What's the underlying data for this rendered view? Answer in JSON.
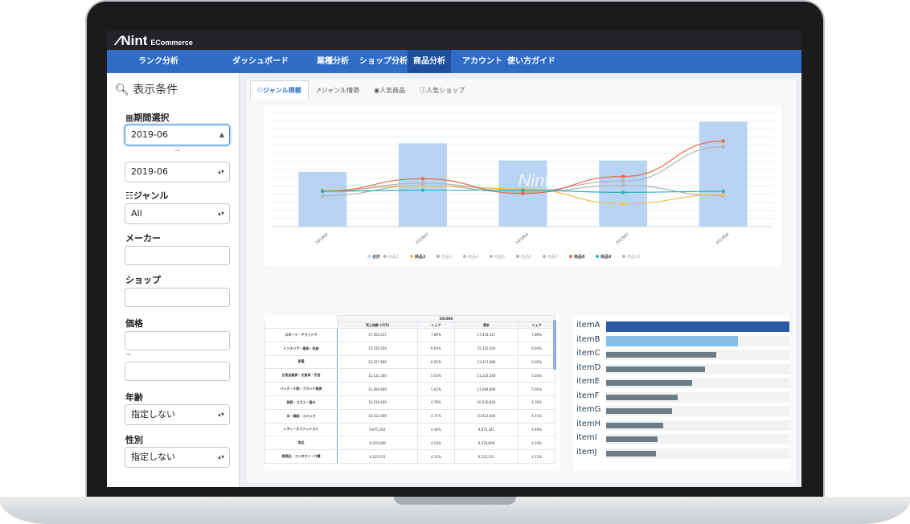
{
  "app": {
    "logo_mark": "∕∕",
    "logo_name": "Nint",
    "logo_sub": "ECommerce"
  },
  "nav": [
    {
      "label": "ランク分析",
      "active": false
    },
    {
      "label": "ダッシュボード",
      "active": false
    },
    {
      "label": "業種分析",
      "active": false
    },
    {
      "label": "ショップ分析",
      "active": false
    },
    {
      "label": "商品分析",
      "active": true
    },
    {
      "label": "アカウント",
      "active": false
    },
    {
      "label": "使い方ガイド",
      "active": false
    }
  ],
  "sidebar": {
    "title": "表示条件",
    "period_label": "期間選択",
    "period_from": "2019-06",
    "period_sep": "~",
    "period_to": "2019-06",
    "genre_label": "ジャンル",
    "genre_value": "All",
    "maker_label": "メーカー",
    "shop_label": "ショップ",
    "price_label": "価格",
    "price_sep": "~",
    "age_label": "年齢",
    "age_value": "指定しない",
    "gender_label": "性別",
    "gender_value": "指定しない"
  },
  "tabs": [
    {
      "label": "ジャンル規模",
      "icon": "users-icon",
      "active": true
    },
    {
      "label": "ジャンル情勢",
      "icon": "line-chart-icon",
      "active": false
    },
    {
      "label": "人気商品",
      "icon": "eye-icon",
      "active": false
    },
    {
      "label": "人気ショップ",
      "icon": "info-icon",
      "active": false
    }
  ],
  "chart_data": {
    "type": "bar",
    "categories": [
      "201902",
      "201903",
      "201904",
      "201905",
      "201906"
    ],
    "ylim": [
      0,
      100
    ],
    "grid": true,
    "legend_position": "bottom",
    "watermark": "Nint",
    "series": [
      {
        "name": "合計",
        "kind": "bar",
        "color": "#b9d4f3",
        "values": [
          48,
          73,
          58,
          58,
          92
        ]
      },
      {
        "name": "商品1",
        "kind": "line",
        "color": "#b0b4b8",
        "values": [
          27,
          36,
          30,
          36,
          27
        ]
      },
      {
        "name": "商品2",
        "kind": "line",
        "color": "#f0c050",
        "values": [
          32,
          36,
          33,
          20,
          28
        ]
      },
      {
        "name": "商品3",
        "kind": "line",
        "color": "#b0b4b8",
        "values": [
          31,
          38,
          31,
          40,
          70
        ]
      },
      {
        "name": "商品4",
        "kind": "line",
        "color": "#b0b4b8",
        "values": []
      },
      {
        "name": "商品5",
        "kind": "line",
        "color": "#b0b4b8",
        "values": []
      },
      {
        "name": "商品6",
        "kind": "line",
        "color": "#b0b4b8",
        "values": []
      },
      {
        "name": "商品7",
        "kind": "line",
        "color": "#b0b4b8",
        "values": []
      },
      {
        "name": "商品8",
        "kind": "line",
        "color": "#e8684a",
        "values": [
          31,
          42,
          29,
          44,
          75
        ]
      },
      {
        "name": "商品9",
        "kind": "line",
        "color": "#2ab0b8",
        "values": [
          31,
          32,
          32,
          30,
          31
        ]
      },
      {
        "name": "商品10",
        "kind": "line",
        "color": "#b0b4b8",
        "values": []
      }
    ]
  },
  "table": {
    "period": "201906",
    "headers": [
      "",
      "売上指数 (千円)",
      "シェア",
      "累計",
      "シェア"
    ],
    "rows": [
      [
        "スポーツ・アウトドア",
        "17,454,017",
        "7.89%",
        "17,454,017",
        "7.89%"
      ],
      [
        "インテリア・寝具・収納",
        "15,335,504",
        "6.93%",
        "15,335,504",
        "6.93%"
      ],
      [
        "家電",
        "13,317,696",
        "6.02%",
        "13,317,696",
        "6.02%"
      ],
      [
        "日用品雑貨・文房具・手芸",
        "11,132,340",
        "5.03%",
        "11,132,340",
        "5.03%"
      ],
      [
        "バッグ・小物・ブランド雑貨",
        "11,094,809",
        "5.02%",
        "11,094,809",
        "5.02%"
      ],
      [
        "美容・コスメ・香水",
        "10,530,820",
        "4.76%",
        "10,530,820",
        "4.76%"
      ],
      [
        "本・雑誌・コミック",
        "10,412,046",
        "4.71%",
        "10,412,046",
        "4.71%"
      ],
      [
        "レディースファッション",
        "9,875,341",
        "4.46%",
        "9,875,341",
        "4.46%"
      ],
      [
        "食品",
        "9,370,609",
        "4.24%",
        "9,370,609",
        "4.24%"
      ],
      [
        "医薬品・コンタクト・介護",
        "9,125,231",
        "4.12%",
        "9,125,231",
        "4.12%"
      ]
    ]
  },
  "ranking": [
    {
      "label": "itemA",
      "value": 100,
      "color": "#2c58a8"
    },
    {
      "label": "itemB",
      "value": 72,
      "color": "#86c0e8"
    },
    {
      "label": "itemC",
      "value": 60,
      "color": "#6e7c86"
    },
    {
      "label": "itemD",
      "value": 54,
      "color": "#6e7c86"
    },
    {
      "label": "itemE",
      "value": 47,
      "color": "#6e7c86"
    },
    {
      "label": "itemF",
      "value": 39,
      "color": "#6e7c86"
    },
    {
      "label": "itemG",
      "value": 36,
      "color": "#6e7c86"
    },
    {
      "label": "itemH",
      "value": 31,
      "color": "#6e7c86"
    },
    {
      "label": "itemI",
      "value": 28,
      "color": "#6e7c86"
    },
    {
      "label": "itemJ",
      "value": 27,
      "color": "#6e7c86"
    }
  ]
}
